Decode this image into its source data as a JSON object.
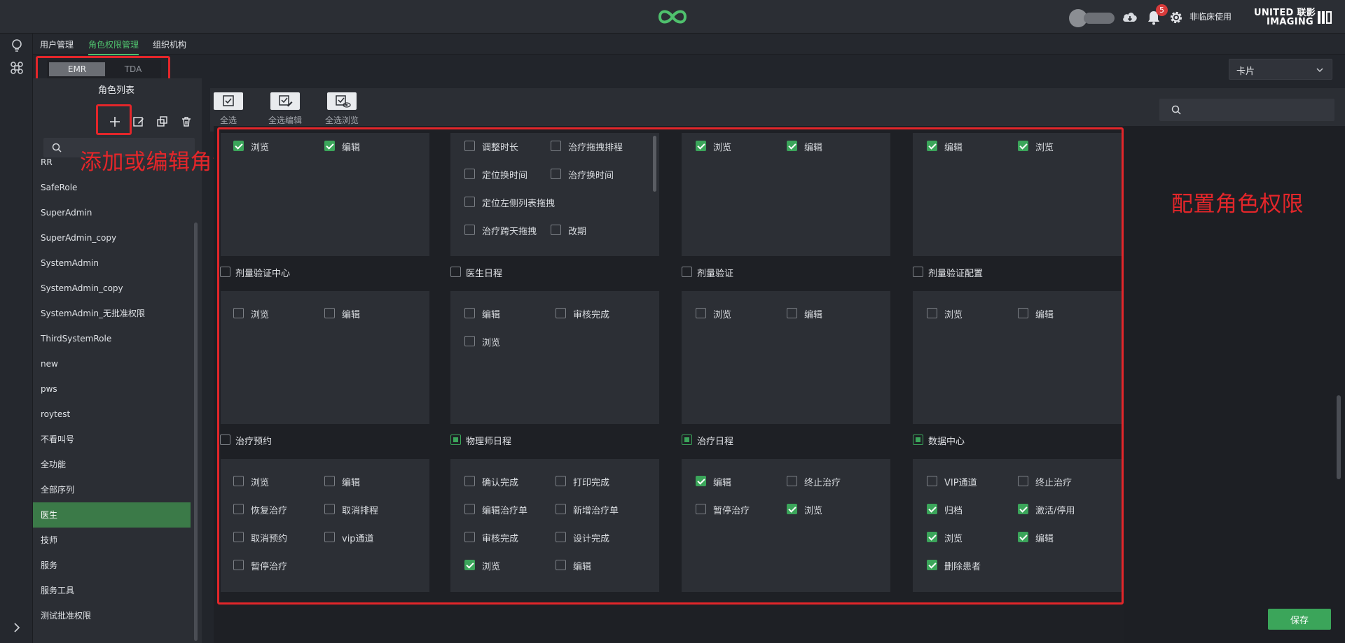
{
  "header": {
    "notification_count": "5",
    "user_label": "非临床使用",
    "brand_line1": "UNITED 联影",
    "brand_line2": "IMAGING",
    "brand_color": "#4fc06d"
  },
  "nav": {
    "tabs": [
      {
        "label": "用户管理"
      },
      {
        "label": "角色权限管理"
      },
      {
        "label": "组织机构"
      }
    ],
    "active_tab": "角色权限管理"
  },
  "segment": {
    "options": [
      "EMR",
      "TDA"
    ],
    "selected": "EMR"
  },
  "view_select": {
    "value": "卡片"
  },
  "roles": {
    "title": "角色列表",
    "items": [
      "RR",
      "SafeRole",
      "SuperAdmin",
      "SuperAdmin_copy",
      "SystemAdmin",
      "SystemAdmin_copy",
      "SystemAdmin_无批准权限",
      "ThirdSystemRole",
      "new",
      "pws",
      "roytest",
      "不看叫号",
      "全功能",
      "全部序列",
      "医生",
      "技师",
      "服务",
      "服务工具",
      "测试批准权限"
    ],
    "selected": "医生"
  },
  "annotations": {
    "add_edit_role": "添加或编辑角色",
    "configure_permissions": "配置角色权限"
  },
  "toolbar": {
    "select_all": "全选",
    "select_all_edit": "全选编辑",
    "select_all_browse": "全选浏览"
  },
  "sections": [
    {
      "row": 0,
      "cards": [
        {
          "items": [
            {
              "label": "浏览",
              "checked": true
            },
            {
              "label": "编辑",
              "checked": true
            }
          ]
        },
        {
          "items": [
            {
              "label": "调整时长",
              "checked": false
            },
            {
              "label": "治疗拖拽排程",
              "checked": false
            },
            {
              "label": "定位换时间",
              "checked": false
            },
            {
              "label": "治疗换时间",
              "checked": false
            },
            {
              "label": "定位左侧列表拖拽",
              "checked": false
            },
            {
              "label": "治疗跨天拖拽",
              "checked": false
            },
            {
              "label": "改期",
              "checked": false
            }
          ]
        },
        {
          "items": [
            {
              "label": "浏览",
              "checked": true
            },
            {
              "label": "编辑",
              "checked": true
            }
          ]
        },
        {
          "items": [
            {
              "label": "编辑",
              "checked": true
            },
            {
              "label": "浏览",
              "checked": true
            }
          ]
        }
      ]
    },
    {
      "row": 1,
      "headers": [
        {
          "label": "剂量验证中心",
          "state": "off"
        },
        {
          "label": "医生日程",
          "state": "off"
        },
        {
          "label": "剂量验证",
          "state": "off"
        },
        {
          "label": "剂量验证配置",
          "state": "off"
        }
      ],
      "cards": [
        {
          "items": [
            {
              "label": "浏览",
              "checked": false
            },
            {
              "label": "编辑",
              "checked": false
            }
          ]
        },
        {
          "items": [
            {
              "label": "编辑",
              "checked": false
            },
            {
              "label": "审核完成",
              "checked": false
            },
            {
              "label": "浏览",
              "checked": false
            }
          ]
        },
        {
          "items": [
            {
              "label": "浏览",
              "checked": false
            },
            {
              "label": "编辑",
              "checked": false
            }
          ]
        },
        {
          "items": [
            {
              "label": "浏览",
              "checked": false
            },
            {
              "label": "编辑",
              "checked": false
            }
          ]
        }
      ]
    },
    {
      "row": 2,
      "headers": [
        {
          "label": "治疗预约",
          "state": "off"
        },
        {
          "label": "物理师日程",
          "state": "partial"
        },
        {
          "label": "治疗日程",
          "state": "partial"
        },
        {
          "label": "数据中心",
          "state": "partial"
        }
      ],
      "cards": [
        {
          "items": [
            {
              "label": "浏览",
              "checked": false
            },
            {
              "label": "编辑",
              "checked": false
            },
            {
              "label": "恢复治疗",
              "checked": false
            },
            {
              "label": "取消排程",
              "checked": false
            },
            {
              "label": "取消预约",
              "checked": false
            },
            {
              "label": "vip通道",
              "checked": false
            },
            {
              "label": "暂停治疗",
              "checked": false
            }
          ]
        },
        {
          "items": [
            {
              "label": "确认完成",
              "checked": false
            },
            {
              "label": "打印完成",
              "checked": false
            },
            {
              "label": "编辑治疗单",
              "checked": false
            },
            {
              "label": "新增治疗单",
              "checked": false
            },
            {
              "label": "审核完成",
              "checked": false
            },
            {
              "label": "设计完成",
              "checked": false
            },
            {
              "label": "浏览",
              "checked": true
            },
            {
              "label": "编辑",
              "checked": false
            }
          ]
        },
        {
          "items": [
            {
              "label": "编辑",
              "checked": true
            },
            {
              "label": "终止治疗",
              "checked": false
            },
            {
              "label": "暂停治疗",
              "checked": false
            },
            {
              "label": "浏览",
              "checked": true
            }
          ]
        },
        {
          "items": [
            {
              "label": "VIP通道",
              "checked": false
            },
            {
              "label": "终止治疗",
              "checked": false
            },
            {
              "label": "归档",
              "checked": true
            },
            {
              "label": "激活/停用",
              "checked": true
            },
            {
              "label": "浏览",
              "checked": true
            },
            {
              "label": "编辑",
              "checked": true
            },
            {
              "label": "删除患者",
              "checked": true
            }
          ]
        }
      ]
    }
  ],
  "save_label": "保存"
}
